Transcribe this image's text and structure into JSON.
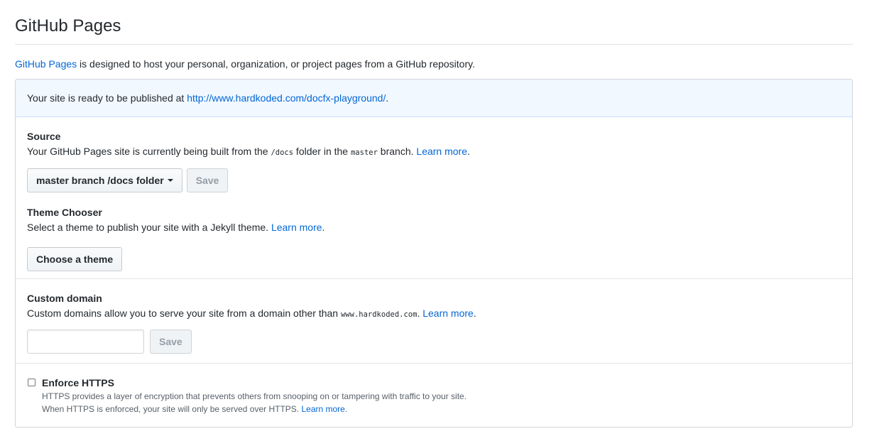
{
  "page": {
    "title": "GitHub Pages",
    "intro_link": "GitHub Pages",
    "intro_text": " is designed to host your personal, organization, or project pages from a GitHub repository."
  },
  "flash": {
    "text": "Your site is ready to be published at ",
    "url": "http://www.hardkoded.com/docfx-playground/",
    "suffix": "."
  },
  "source": {
    "label": "Source",
    "desc_1": "Your GitHub Pages site is currently being built from the ",
    "folder": "/docs",
    "desc_2": " folder in the ",
    "branch": "master",
    "desc_3": " branch. ",
    "learn_more": "Learn more",
    "desc_end": ".",
    "dropdown_label": "master branch /docs folder",
    "save_label": "Save"
  },
  "theme": {
    "label": "Theme Chooser",
    "desc": "Select a theme to publish your site with a Jekyll theme. ",
    "learn_more": "Learn more",
    "desc_end": ".",
    "button_label": "Choose a theme"
  },
  "custom_domain": {
    "label": "Custom domain",
    "desc": "Custom domains allow you to serve your site from a domain other than ",
    "domain": "www.hardkoded.com",
    "desc_2": ". ",
    "learn_more": "Learn more",
    "desc_end": ".",
    "input_value": "",
    "save_label": "Save"
  },
  "https": {
    "label": "Enforce HTTPS",
    "checked": false,
    "note_1": "HTTPS provides a layer of encryption that prevents others from snooping on or tampering with traffic to your site.",
    "note_2": "When HTTPS is enforced, your site will only be served over HTTPS. ",
    "learn_more": "Learn more",
    "note_end": "."
  },
  "colors": {
    "link": "#0366d6",
    "flash_bg": "#f1f8ff",
    "border": "#d1d5da",
    "text": "#24292e",
    "muted": "#586069",
    "disabled_text": "#959da5"
  },
  "icons": {
    "dropdown": "caret-down-icon"
  }
}
